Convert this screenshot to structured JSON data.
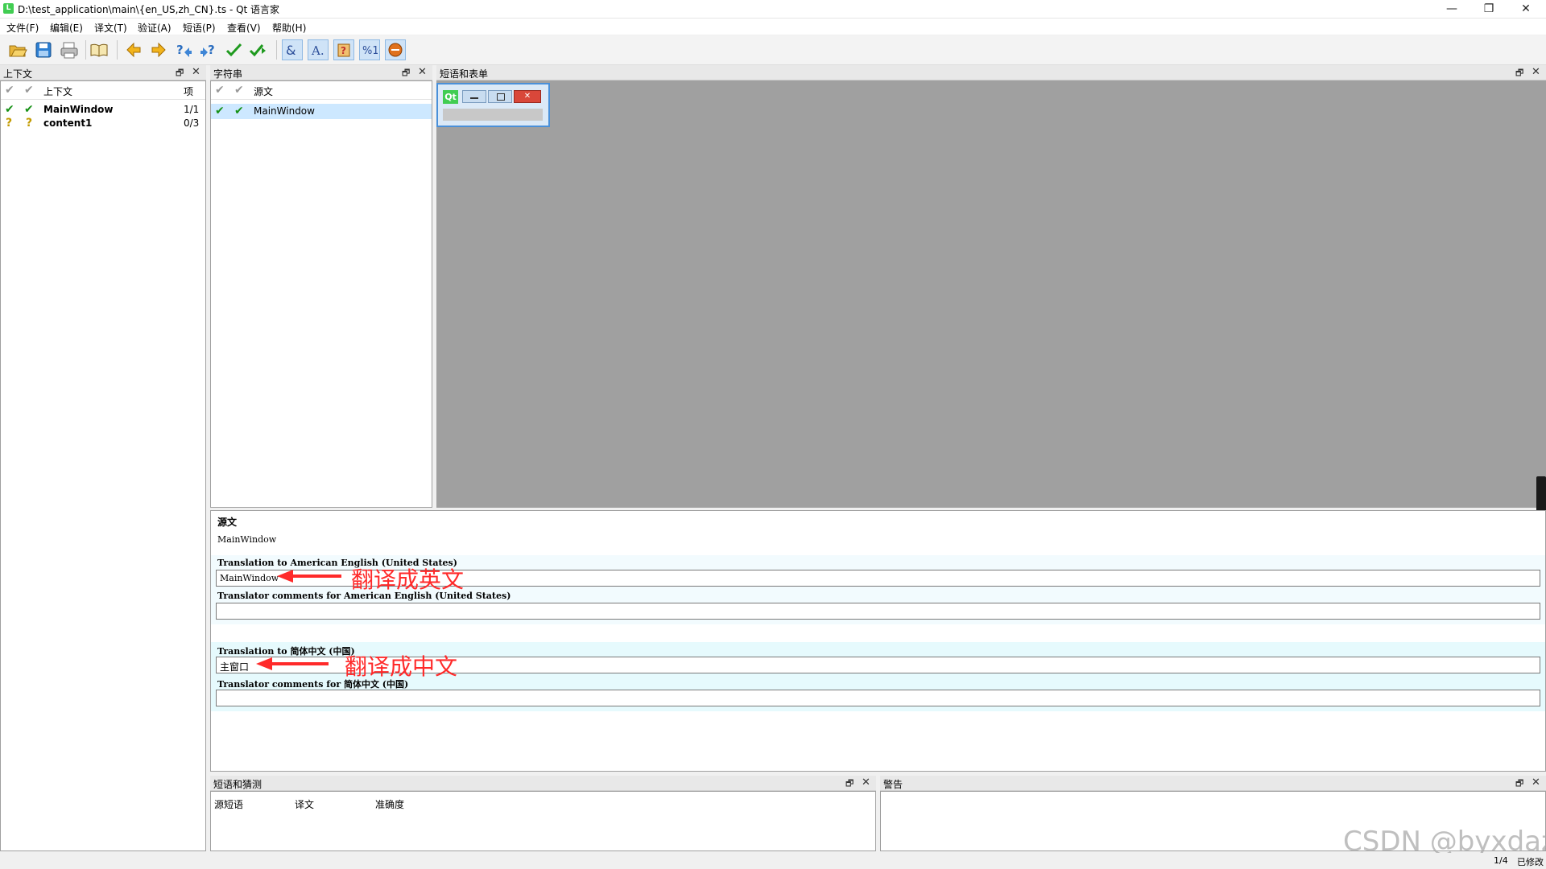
{
  "window": {
    "title": "D:\\test_application\\main\\{en_US,zh_CN}.ts - Qt 语言家",
    "minimize": "—",
    "restore": "❐",
    "close": "✕"
  },
  "menu": [
    "文件(F)",
    "编辑(E)",
    "译文(T)",
    "验证(A)",
    "短语(P)",
    "查看(V)",
    "帮助(H)"
  ],
  "toolbar_icons": [
    "open-icon",
    "save-icon",
    "print-icon",
    "phrasebook-icon",
    "prev-icon",
    "next-icon",
    "prev-unfinished-icon",
    "next-unfinished-icon",
    "done-icon",
    "done-next-icon",
    "accelerator-check-icon",
    "punctuation-check-icon",
    "phrase-check-icon",
    "placeholder-check-icon",
    "surrounding-whitespace-check-icon"
  ],
  "context_dock": {
    "title": "上下文",
    "col_context": "上下文",
    "col_items": "项",
    "rows": [
      {
        "name": "MainWindow",
        "count": "1/1",
        "state": "done"
      },
      {
        "name": "content1",
        "count": "0/3",
        "state": "unfinished"
      }
    ]
  },
  "strings_dock": {
    "title": "字符串",
    "col_source": "源文",
    "rows": [
      {
        "source": "MainWindow",
        "state": "done"
      }
    ]
  },
  "forms_dock": {
    "title": "短语和表单",
    "preview_logo": "Qt"
  },
  "editor": {
    "source_label": "源文",
    "source_text": "MainWindow",
    "en_translation_label": "Translation to American English (United States)",
    "en_translation_value": "MainWindow",
    "en_comment_label": "Translator comments for American English (United States)",
    "en_comment_value": "",
    "zh_translation_label": "Translation to 简体中文 (中国)",
    "zh_translation_value": "主窗口",
    "zh_comment_label": "Translator comments for 简体中文 (中国)",
    "zh_comment_value": ""
  },
  "annotations": {
    "to_english": "翻译成英文",
    "to_chinese": "翻译成中文",
    "arrow_color": "#ff2a2a"
  },
  "phrases_dock": {
    "title": "短语和猜测",
    "col_source": "源短语",
    "col_translation": "译文",
    "col_accuracy": "准确度"
  },
  "warnings_dock": {
    "title": "警告"
  },
  "dock_buttons": {
    "float": "🗗",
    "close": "✕"
  },
  "statusbar": {
    "position": "1/4",
    "state": "已修改"
  },
  "watermark": "CSDN @byxdaz"
}
